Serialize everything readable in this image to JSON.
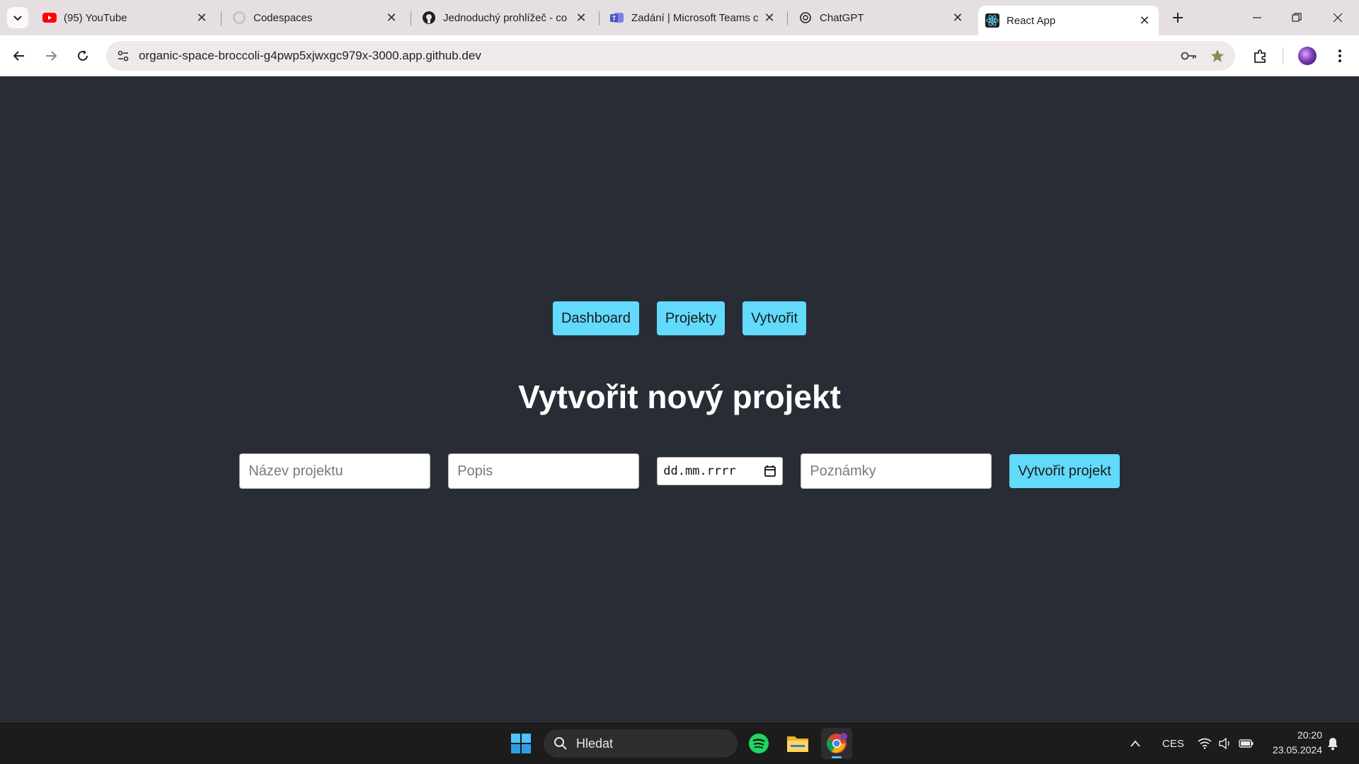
{
  "browser": {
    "tabs": [
      {
        "title": "(95) YouTube",
        "icon": "youtube-icon"
      },
      {
        "title": "Codespaces",
        "icon": "github-icon"
      },
      {
        "title": "Jednoduchý prohlížeč - co",
        "icon": "github-icon"
      },
      {
        "title": "Zadání | Microsoft Teams c",
        "icon": "teams-icon"
      },
      {
        "title": "ChatGPT",
        "icon": "chatgpt-icon"
      },
      {
        "title": "React App",
        "icon": "react-icon",
        "active": true
      }
    ],
    "url": "organic-space-broccoli-g4pwp5xjwxgc979x-3000.app.github.dev"
  },
  "app": {
    "nav": [
      "Dashboard",
      "Projekty",
      "Vytvořit"
    ],
    "title": "Vytvořit nový projekt",
    "form": {
      "name_placeholder": "Název projektu",
      "description_placeholder": "Popis",
      "date_placeholder": "dd.mm.rrrr",
      "notes_placeholder": "Poznámky",
      "submit_label": "Vytvořit projekt"
    },
    "colors": {
      "background": "#282c34",
      "accent": "#61dafb",
      "title": "#ffffff"
    }
  },
  "taskbar": {
    "search_label": "Hledat",
    "language": "CES",
    "time": "20:20",
    "date": "23.05.2024"
  }
}
